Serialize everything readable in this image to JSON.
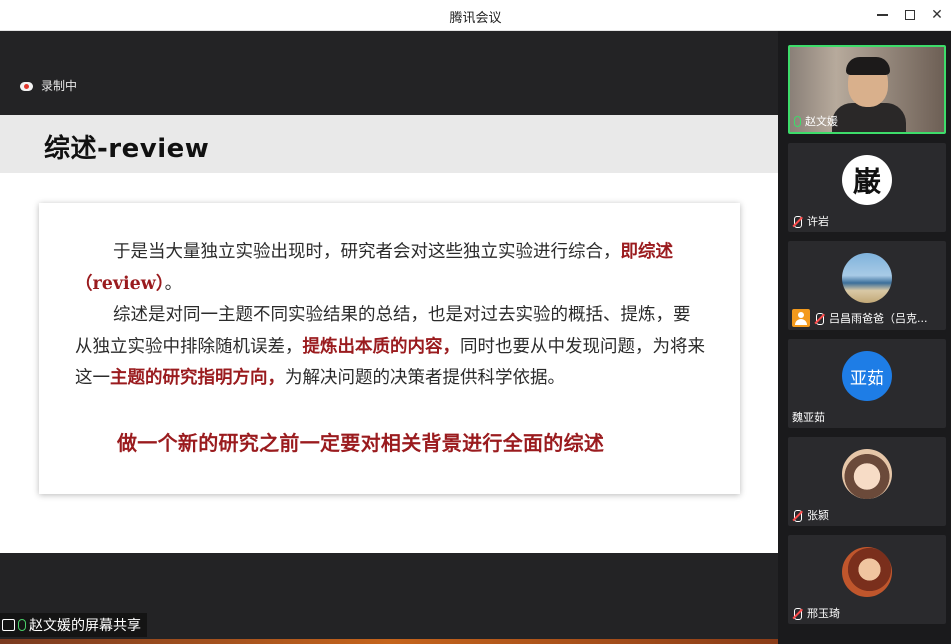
{
  "window": {
    "title": "腾讯会议"
  },
  "recording": {
    "label": "录制中"
  },
  "slide": {
    "heading": "综述-review",
    "p1_text": "于是当大量独立实验出现时，研究者会对这些独立实验进行综合，",
    "p1_red": "即综述（review）",
    "p1_end": "。",
    "p2_a": "综述是对同一主题不同实验结果的总结，也是对过去实验的概括、提炼，要从独立实验中排除随机误差，",
    "p2_red1": "提炼出本质的内容，",
    "p2_b": "同时也要从中发现问题，为将来这一",
    "p2_red2": "主题的研究指明方向，",
    "p2_c": "为解决问题的决策者提供科学依据。",
    "highlight": "做一个新的研究之前一定要对相关背景进行全面的综述"
  },
  "share_bar": {
    "label": "赵文媛的屏幕共享"
  },
  "participants": [
    {
      "name": "赵文媛"
    },
    {
      "name": "许岩",
      "avatar_text": "巌"
    },
    {
      "name": "吕昌雨爸爸（吕克..."
    },
    {
      "name": "魏亚茹",
      "avatar_text": "亚茹"
    },
    {
      "name": "张颍"
    },
    {
      "name": "邢玉琦"
    }
  ],
  "colors": {
    "accent_red": "#9a1b1e",
    "active_border": "#3ddc6a",
    "avatar_blue": "#1e7de6"
  }
}
